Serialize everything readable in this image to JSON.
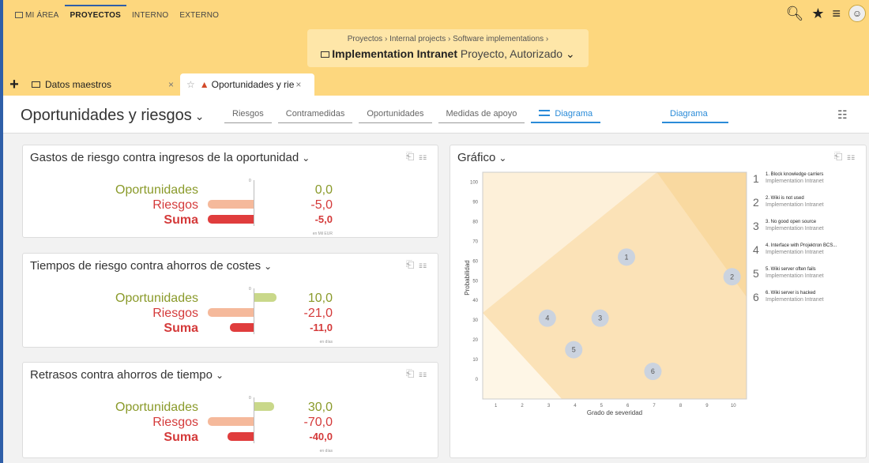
{
  "topnav": {
    "items": [
      "MI ÁREA",
      "PROYECTOS",
      "INTERNO",
      "EXTERNO"
    ]
  },
  "breadcrumb": {
    "path": "Proyectos  ›  Internal projects  ›  Software implementations  ›",
    "project": "Implementation Intranet",
    "status": "Proyecto, Autorizado"
  },
  "tabs": [
    {
      "label": "Datos maestros",
      "close": "×"
    },
    {
      "label": "Oportunidades y rie",
      "close": "×"
    }
  ],
  "page": {
    "title": "Oportunidades y riesgos"
  },
  "subtabs": [
    "Riesgos",
    "Contramedidas",
    "Oportunidades",
    "Medidas de apoyo",
    "Diagrama"
  ],
  "subtab_right": "Diagrama",
  "cards": [
    {
      "title": "Gastos de riesgo contra ingresos de la oportunidad",
      "rows": [
        {
          "label": "Oportunidades",
          "value": "0,0",
          "num": 0
        },
        {
          "label": "Riesgos",
          "value": "-5,0",
          "num": -5
        },
        {
          "label": "Suma",
          "value": "-5,0",
          "num": -5
        }
      ],
      "unit": "en Mil EUR",
      "scale": 5,
      "zero": "0"
    },
    {
      "title": "Tiempos de riesgo contra ahorros de costes",
      "rows": [
        {
          "label": "Oportunidades",
          "value": "10,0",
          "num": 10
        },
        {
          "label": "Riesgos",
          "value": "-21,0",
          "num": -21
        },
        {
          "label": "Suma",
          "value": "-11,0",
          "num": -11
        }
      ],
      "unit": "en días",
      "scale": 21,
      "zero": "0"
    },
    {
      "title": "Retrasos contra ahorros de tiempo",
      "rows": [
        {
          "label": "Oportunidades",
          "value": "30,0",
          "num": 30
        },
        {
          "label": "Riesgos",
          "value": "-70,0",
          "num": -70
        },
        {
          "label": "Suma",
          "value": "-40,0",
          "num": -40
        }
      ],
      "unit": "en días",
      "scale": 70,
      "zero": "0"
    }
  ],
  "chart_card": {
    "title": "Gráfico"
  },
  "chart_data": {
    "type": "scatter",
    "xlabel": "Grado de severidad",
    "ylabel": "Probabilidad",
    "xticks": [
      1,
      2,
      3,
      4,
      5,
      6,
      7,
      8,
      9,
      10
    ],
    "yticks": [
      0,
      10,
      20,
      30,
      40,
      50,
      60,
      70,
      80,
      90,
      100
    ],
    "xlim": [
      0.5,
      10.5
    ],
    "ylim": [
      -10,
      105
    ],
    "points": [
      {
        "id": "1",
        "x": 5.95,
        "y": 62
      },
      {
        "id": "2",
        "x": 9.95,
        "y": 52
      },
      {
        "id": "3",
        "x": 4.95,
        "y": 31
      },
      {
        "id": "4",
        "x": 2.95,
        "y": 31
      },
      {
        "id": "5",
        "x": 3.95,
        "y": 15
      },
      {
        "id": "6",
        "x": 6.95,
        "y": 4
      }
    ],
    "legend": [
      {
        "num": "1",
        "title": "1. Block knowledge carriers",
        "sub": "Implementation Intranet"
      },
      {
        "num": "2",
        "title": "2. Wiki is not used",
        "sub": "Implementation Intranet"
      },
      {
        "num": "3",
        "title": "3. No good open source",
        "sub": "Implementation Intranet"
      },
      {
        "num": "4",
        "title": "4. Interface with Projektron BCS...",
        "sub": "Implementation Intranet"
      },
      {
        "num": "5",
        "title": "5. Wiki server often fails",
        "sub": "Implementation Intranet"
      },
      {
        "num": "6",
        "title": "6. Wiki server is hacked",
        "sub": "Implementation Intranet"
      }
    ],
    "colors": {
      "dark": "#fbe2b7",
      "light": "#fdf0d9",
      "point": "#cbd3df"
    }
  }
}
